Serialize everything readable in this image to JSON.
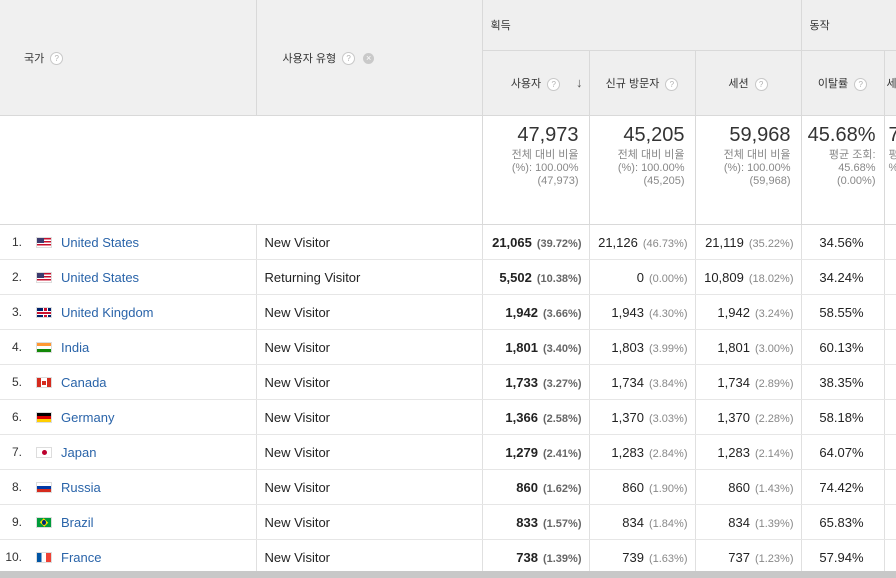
{
  "header": {
    "dim1": "국가",
    "dim2": "사용자 유형",
    "group_acquisition": "획득",
    "group_behavior": "동작",
    "col_users": "사용자",
    "col_new_users": "신규 방문자",
    "col_sessions": "세션",
    "col_bounce": "이탈률",
    "col_pages_partial": "세"
  },
  "summary": {
    "users": {
      "value": "47,973",
      "l1": "전체 대비 비율",
      "l2": "(%): 100.00%",
      "l3": "(47,973)"
    },
    "new_users": {
      "value": "45,205",
      "l1": "전체 대비 비율",
      "l2": "(%): 100.00%",
      "l3": "(45,205)"
    },
    "sessions": {
      "value": "59,968",
      "l1": "전체 대비 비율",
      "l2": "(%): 100.00%",
      "l3": "(59,968)"
    },
    "bounce": {
      "value": "45.68%",
      "l1": "평균 조회:",
      "l2": "45.68%",
      "l3": "(0.00%)"
    },
    "partial": {
      "value": "7",
      "l1": "평",
      "l2": "",
      "l3": "%"
    }
  },
  "rows": [
    {
      "idx": "1.",
      "flag": "us",
      "country": "United States",
      "type": "New Visitor",
      "users": "21,065",
      "users_pct": "(39.72%)",
      "new": "21,126",
      "new_pct": "(46.73%)",
      "sessions": "21,119",
      "sessions_pct": "(35.22%)",
      "bounce": "34.56%"
    },
    {
      "idx": "2.",
      "flag": "us",
      "country": "United States",
      "type": "Returning Visitor",
      "users": "5,502",
      "users_pct": "(10.38%)",
      "new": "0",
      "new_pct": "(0.00%)",
      "sessions": "10,809",
      "sessions_pct": "(18.02%)",
      "bounce": "34.24%"
    },
    {
      "idx": "3.",
      "flag": "uk",
      "country": "United Kingdom",
      "type": "New Visitor",
      "users": "1,942",
      "users_pct": "(3.66%)",
      "new": "1,943",
      "new_pct": "(4.30%)",
      "sessions": "1,942",
      "sessions_pct": "(3.24%)",
      "bounce": "58.55%"
    },
    {
      "idx": "4.",
      "flag": "in",
      "country": "India",
      "type": "New Visitor",
      "users": "1,801",
      "users_pct": "(3.40%)",
      "new": "1,803",
      "new_pct": "(3.99%)",
      "sessions": "1,801",
      "sessions_pct": "(3.00%)",
      "bounce": "60.13%"
    },
    {
      "idx": "5.",
      "flag": "ca",
      "country": "Canada",
      "type": "New Visitor",
      "users": "1,733",
      "users_pct": "(3.27%)",
      "new": "1,734",
      "new_pct": "(3.84%)",
      "sessions": "1,734",
      "sessions_pct": "(2.89%)",
      "bounce": "38.35%"
    },
    {
      "idx": "6.",
      "flag": "de",
      "country": "Germany",
      "type": "New Visitor",
      "users": "1,366",
      "users_pct": "(2.58%)",
      "new": "1,370",
      "new_pct": "(3.03%)",
      "sessions": "1,370",
      "sessions_pct": "(2.28%)",
      "bounce": "58.18%"
    },
    {
      "idx": "7.",
      "flag": "jp",
      "country": "Japan",
      "type": "New Visitor",
      "users": "1,279",
      "users_pct": "(2.41%)",
      "new": "1,283",
      "new_pct": "(2.84%)",
      "sessions": "1,283",
      "sessions_pct": "(2.14%)",
      "bounce": "64.07%"
    },
    {
      "idx": "8.",
      "flag": "ru",
      "country": "Russia",
      "type": "New Visitor",
      "users": "860",
      "users_pct": "(1.62%)",
      "new": "860",
      "new_pct": "(1.90%)",
      "sessions": "860",
      "sessions_pct": "(1.43%)",
      "bounce": "74.42%"
    },
    {
      "idx": "9.",
      "flag": "br",
      "country": "Brazil",
      "type": "New Visitor",
      "users": "833",
      "users_pct": "(1.57%)",
      "new": "834",
      "new_pct": "(1.84%)",
      "sessions": "834",
      "sessions_pct": "(1.39%)",
      "bounce": "65.83%"
    },
    {
      "idx": "10.",
      "flag": "fr",
      "country": "France",
      "type": "New Visitor",
      "users": "738",
      "users_pct": "(1.39%)",
      "new": "739",
      "new_pct": "(1.63%)",
      "sessions": "737",
      "sessions_pct": "(1.23%)",
      "bounce": "57.94%"
    }
  ]
}
